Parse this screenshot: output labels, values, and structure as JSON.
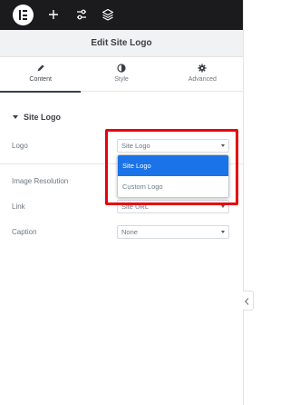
{
  "toolbar": {
    "logo_icon": "elementor-logo-icon",
    "add_icon": "plus-icon",
    "settings_icon": "sliders-icon",
    "structure_icon": "layers-icon"
  },
  "panel": {
    "title": "Edit Site Logo",
    "tabs": [
      {
        "label": "Content",
        "icon": "pencil-icon",
        "active": true
      },
      {
        "label": "Style",
        "icon": "contrast-icon",
        "active": false
      },
      {
        "label": "Advanced",
        "icon": "gear-icon",
        "active": false
      }
    ],
    "section": {
      "title": "Site Logo"
    },
    "controls": {
      "logo": {
        "label": "Logo",
        "value": "Site Logo"
      },
      "image_resolution": {
        "label": "Image Resolution"
      },
      "link": {
        "label": "Link",
        "value": "Site URL"
      },
      "caption": {
        "label": "Caption",
        "value": "None"
      }
    },
    "dropdown": {
      "options": [
        "Site Logo",
        "Custom Logo"
      ],
      "selected": "Site Logo"
    }
  },
  "colors": {
    "toolbar_bg": "#1b1b1d",
    "selected_option": "#1a73e8",
    "highlight": "#e8000f"
  }
}
